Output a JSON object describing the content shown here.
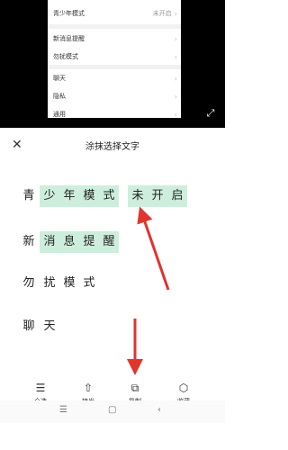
{
  "preview": {
    "rows": [
      {
        "label": "青少年模式",
        "value": "未开启"
      },
      {
        "label": "新消息提醒",
        "value": ""
      },
      {
        "label": "勿扰模式",
        "value": ""
      },
      {
        "label": "聊天",
        "value": ""
      },
      {
        "label": "隐私",
        "value": ""
      },
      {
        "label": "通用",
        "value": ""
      }
    ],
    "chevron": "›",
    "expand_icon": "⤢"
  },
  "sheet": {
    "title": "涂抹选择文字",
    "close_glyph": "✕",
    "lines": [
      {
        "chars": [
          "青",
          "少",
          "年",
          "模",
          "式",
          "未",
          "开",
          "启"
        ],
        "selected": [
          false,
          true,
          true,
          true,
          true,
          true,
          true,
          true
        ]
      },
      {
        "chars": [
          "新",
          "消",
          "息",
          "提",
          "醒"
        ],
        "selected": [
          false,
          true,
          true,
          true,
          true
        ]
      },
      {
        "chars": [
          "勿",
          "扰",
          "模",
          "式"
        ],
        "selected": [
          false,
          false,
          false,
          false
        ]
      },
      {
        "chars": [
          "聊",
          "天"
        ],
        "selected": [
          false,
          false
        ]
      }
    ]
  },
  "toolbar": [
    {
      "label": "全选",
      "icon": "select-all-icon",
      "glyph": "☰"
    },
    {
      "label": "转发",
      "icon": "share-icon",
      "glyph": "⇧"
    },
    {
      "label": "复制",
      "icon": "copy-icon",
      "glyph": "⧉"
    },
    {
      "label": "收藏",
      "icon": "cube-icon",
      "glyph": "⬡"
    }
  ],
  "navbar": {
    "menu": "☰",
    "home": "▢",
    "back": "‹"
  },
  "colors": {
    "selection": "#cdeedc",
    "arrow": "#e0342c"
  }
}
